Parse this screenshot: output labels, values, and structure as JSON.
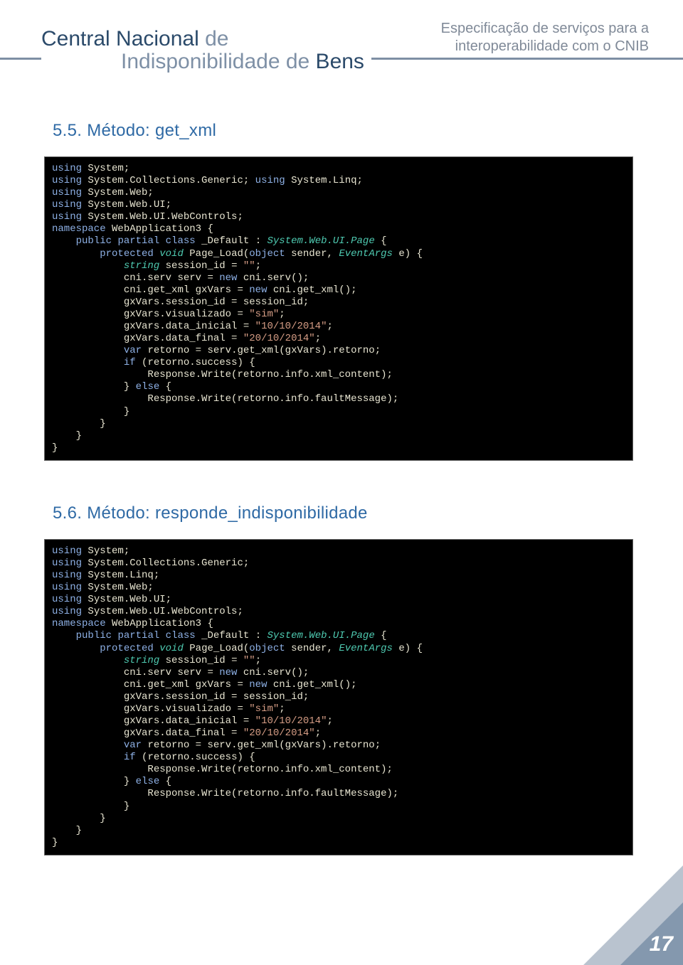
{
  "header": {
    "logo_line1_a": "Central Nacional",
    "logo_line1_b": " de",
    "logo_line2_a": "Indisponibilidade ",
    "logo_line2_b": "de",
    "logo_line2_c": " Bens",
    "right_line1": "Especificação de serviços para a",
    "right_line2": "interoperabilidade com o CNIB"
  },
  "sections": {
    "s55": "5.5. Método: get_xml",
    "s56": "5.6. Método: responde_indisponibilidade"
  },
  "code": {
    "using": "using",
    "system": "System;",
    "sys_coll": "System.Collections.Generic;",
    "linq_same": "System.Linq;",
    "sys_linq": "System.Linq;",
    "sys_web": "System.Web;",
    "sys_webui": "System.Web.UI;",
    "sys_webctrl": "System.Web.UI.WebControls;",
    "namespace": "namespace",
    "ns_name": "WebApplication3 {",
    "public": "public",
    "partial": "partial",
    "class": "class",
    "default": "_Default :",
    "page_type": "System.Web.UI.Page",
    "brace_open": " {",
    "protected": "protected",
    "void": "void",
    "page_load": "Page_Load(",
    "object": "object",
    "sender": " sender, ",
    "eventargs": "EventArgs",
    "e_param": " e",
    "close_paren_brace": ") {",
    "string_t": "string",
    "session_decl": " session_id = ",
    "empty_str": "\"\"",
    "semic": ";",
    "serv_line_a": "cni.serv serv = ",
    "new": "new",
    "serv_line_b": " cni.serv();",
    "getxml_a": "cni.get_xml gxVars = ",
    "getxml_b": " cni.get_xml();",
    "gx_sess": "gxVars.session_id = session_id;",
    "gx_vis": "gxVars.visualizado = ",
    "sim": "\"sim\"",
    "gx_di": "gxVars.data_inicial = ",
    "d1": "\"10/10/2014\"",
    "gx_df": "gxVars.data_final = ",
    "d2": "\"20/10/2014\"",
    "var": "var",
    "retorno_line": " retorno = serv.get_xml(gxVars).retorno;",
    "if": "if",
    "if_cond": " (retorno.success) {",
    "resp_xml": "Response.Write(retorno.info.xml_content);",
    "else": "else",
    "resp_fault": "Response.Write(retorno.info.faultMessage);",
    "brace": "}"
  },
  "page_number": "17"
}
